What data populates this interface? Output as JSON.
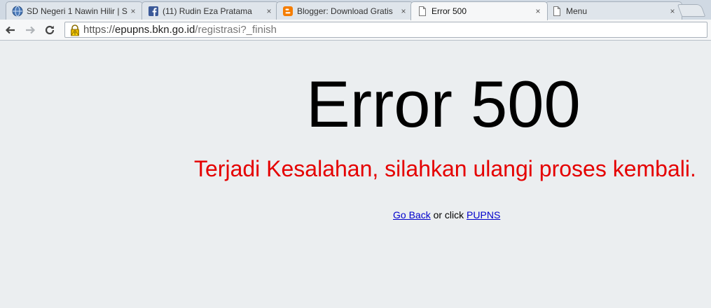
{
  "tabs": [
    {
      "title": "SD Negeri 1 Nawin Hilir | S",
      "icon": "globe-icon",
      "active": false
    },
    {
      "title": "(11) Rudin Eza Pratama",
      "icon": "facebook-icon",
      "active": false
    },
    {
      "title": "Blogger: Download Gratis",
      "icon": "blogger-icon",
      "active": false
    },
    {
      "title": "Error 500",
      "icon": "page-icon",
      "active": true
    },
    {
      "title": "Menu",
      "icon": "page-icon",
      "active": false
    }
  ],
  "close_glyph": "×",
  "address_bar": {
    "scheme": "https://",
    "host": "epupns.bkn.go.id",
    "path": "/registrasi?_finish"
  },
  "page": {
    "title": "Error 500",
    "message": "Terjadi Kesalahan, silahkan ulangi proses kembali.",
    "go_back_label": "Go Back",
    "or_click_text": " or click ",
    "pupns_label": "PUPNS"
  },
  "colors": {
    "message": "#e50000",
    "link": "#0000cc",
    "background": "#ebeef0"
  }
}
